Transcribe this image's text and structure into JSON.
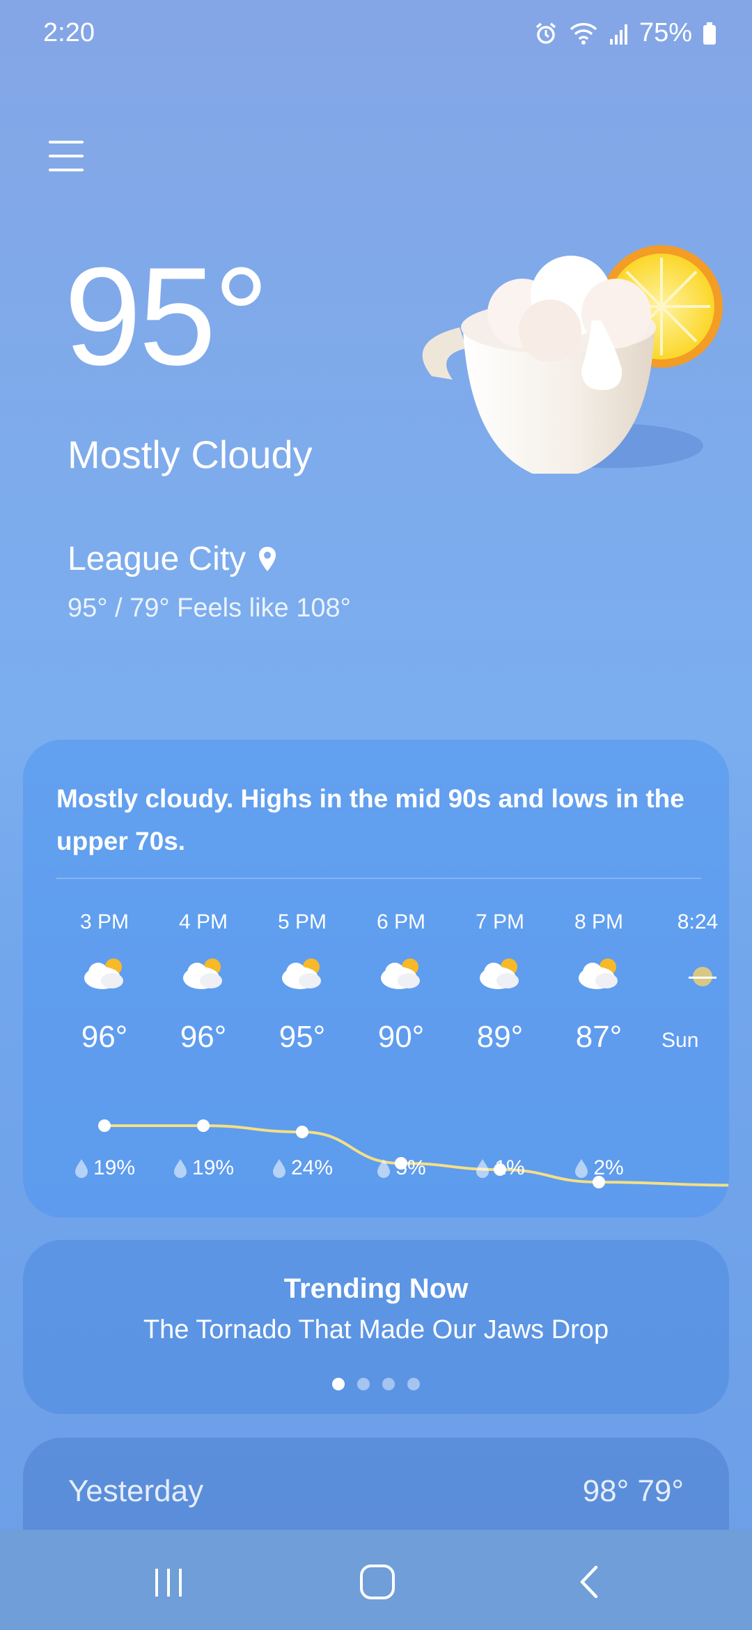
{
  "status_bar": {
    "time": "2:20",
    "battery": "75%"
  },
  "current": {
    "temperature": "95°",
    "condition": "Mostly Cloudy",
    "location": "League City",
    "hi_lo_feels": "95° / 79° Feels like 108°"
  },
  "forecast": {
    "summary": "Mostly cloudy. Highs in the mid 90s and lows in the upper 70s.",
    "hours": [
      {
        "time": "3 PM",
        "icon": "partly-cloudy-icon",
        "temp": "96°",
        "precip": "19%"
      },
      {
        "time": "4 PM",
        "icon": "partly-cloudy-icon",
        "temp": "96°",
        "precip": "19%"
      },
      {
        "time": "5 PM",
        "icon": "partly-cloudy-icon",
        "temp": "95°",
        "precip": "24%"
      },
      {
        "time": "6 PM",
        "icon": "partly-cloudy-icon",
        "temp": "90°",
        "precip": "5%"
      },
      {
        "time": "7 PM",
        "icon": "partly-cloudy-icon",
        "temp": "89°",
        "precip": "1%"
      },
      {
        "time": "8 PM",
        "icon": "partly-cloudy-icon",
        "temp": "87°",
        "precip": "2%"
      },
      {
        "time": "8:24",
        "icon": "sunset-icon",
        "temp": "Sun",
        "precip": ""
      }
    ],
    "line_temps": [
      96,
      96,
      95,
      90,
      89,
      87,
      86.5
    ]
  },
  "trending": {
    "title": "Trending Now",
    "subtitle": "The Tornado That Made Our Jaws Drop",
    "page_count": 4,
    "active_page": 0
  },
  "yesterday": {
    "label": "Yesterday",
    "temps": "98° 79°"
  },
  "colors": {
    "accent_line": "#f3df86",
    "card": "#5b9aef"
  }
}
